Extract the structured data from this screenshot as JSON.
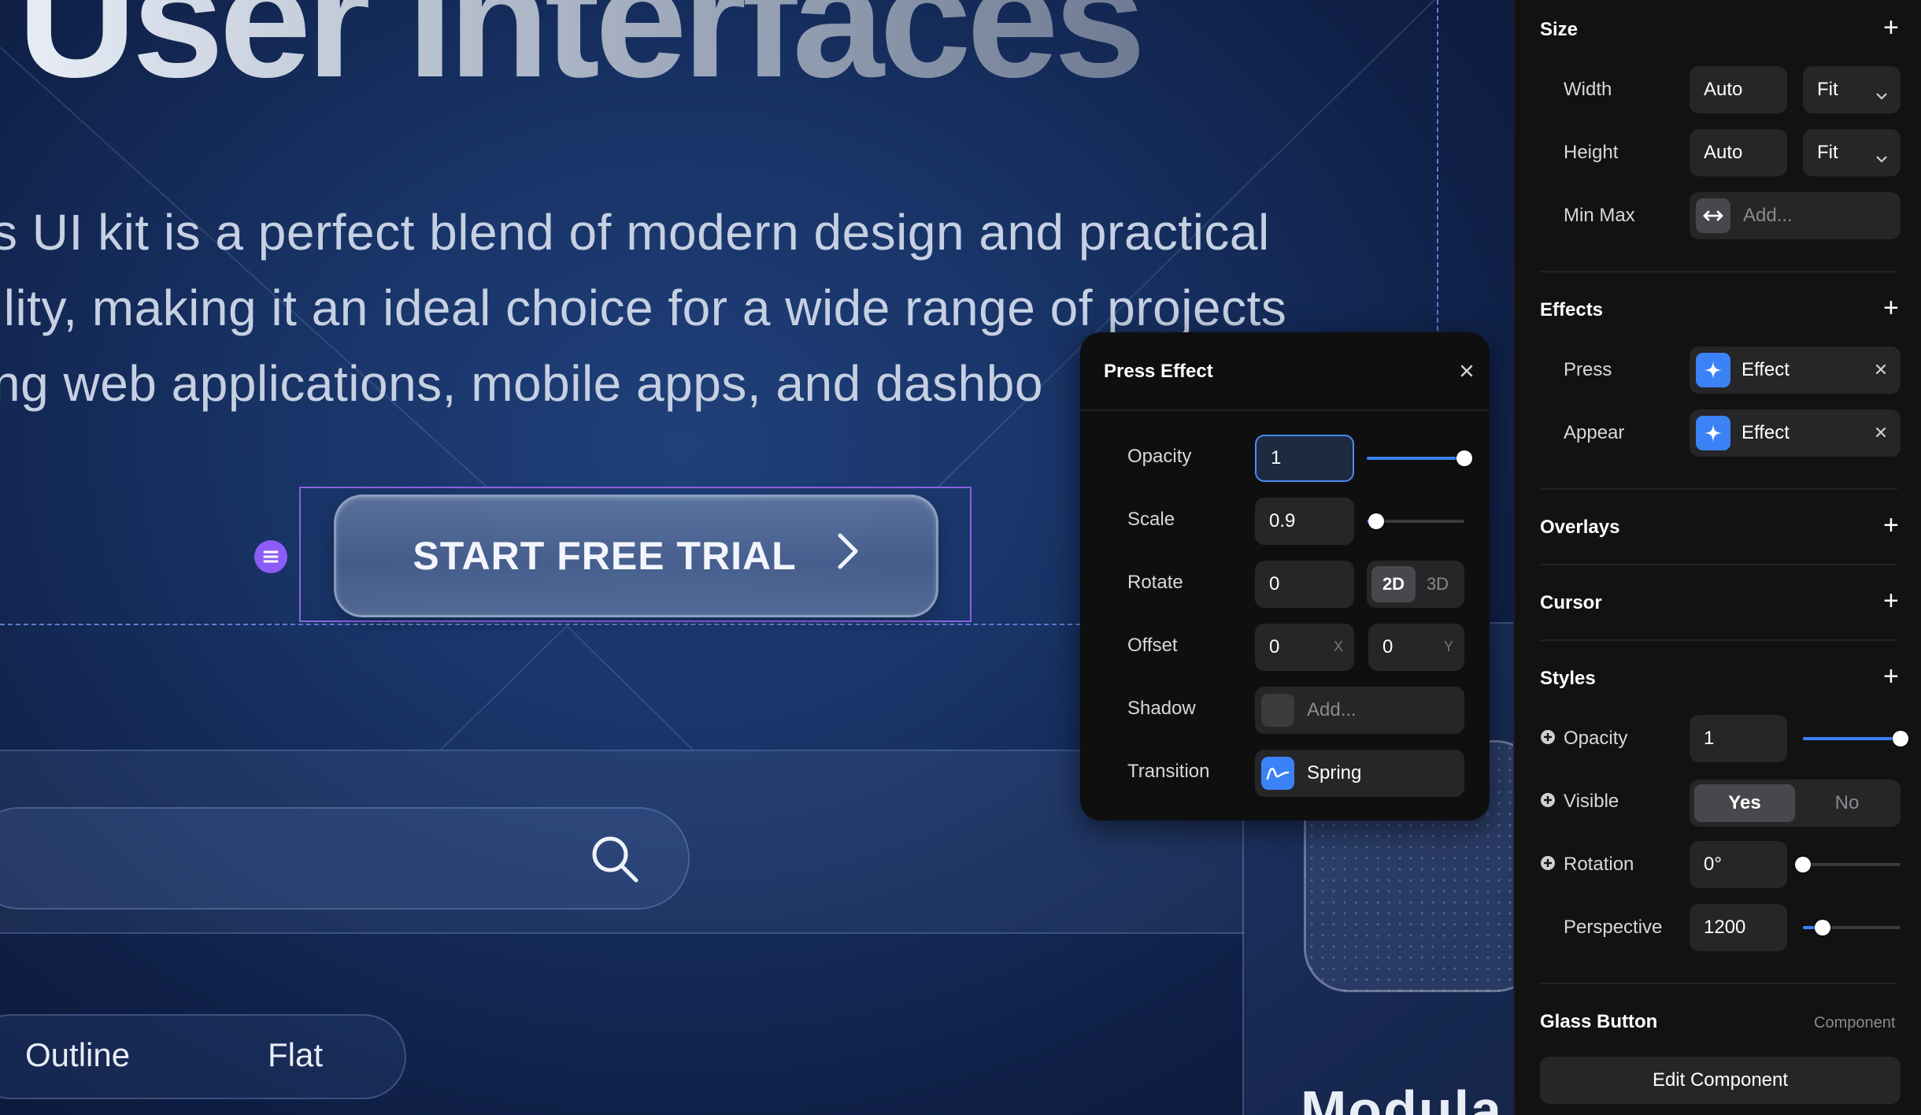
{
  "canvas": {
    "hero_title": "User Interfaces",
    "description_lines": [
      "s UI kit is a perfect blend of modern design and practical",
      "ility, making it an ideal choice for a wide range of projects",
      "ng web applications, mobile apps, and dashbo"
    ],
    "cta_label": "START FREE TRIAL",
    "segment_labels": [
      "Outline",
      "Flat"
    ],
    "bottom_heading": "Modula"
  },
  "popover": {
    "title": "Press Effect",
    "rows": {
      "opacity": {
        "label": "Opacity",
        "value": "1",
        "slider": 1.0
      },
      "scale": {
        "label": "Scale",
        "value": "0.9",
        "slider": 0.1
      },
      "rotate": {
        "label": "Rotate",
        "value": "0",
        "mode_options": [
          "2D",
          "3D"
        ],
        "mode_selected": "2D"
      },
      "offset": {
        "label": "Offset",
        "x": "0",
        "y": "0",
        "x_axis": "X",
        "y_axis": "Y"
      },
      "shadow": {
        "label": "Shadow",
        "placeholder": "Add..."
      },
      "transition": {
        "label": "Transition",
        "value": "Spring"
      }
    }
  },
  "sidebar": {
    "size": {
      "title": "Size",
      "width_label": "Width",
      "width_value": "Auto",
      "width_mode": "Fit",
      "height_label": "Height",
      "height_value": "Auto",
      "height_mode": "Fit",
      "minmax_label": "Min Max",
      "minmax_placeholder": "Add..."
    },
    "effects": {
      "title": "Effects",
      "items": [
        {
          "label": "Press",
          "value": "Effect"
        },
        {
          "label": "Appear",
          "value": "Effect"
        }
      ]
    },
    "overlays_title": "Overlays",
    "cursor_title": "Cursor",
    "styles": {
      "title": "Styles",
      "opacity_label": "Opacity",
      "opacity_value": "1",
      "opacity_slider": 1.0,
      "visible_label": "Visible",
      "visible_options": [
        "Yes",
        "No"
      ],
      "visible_selected": "Yes",
      "rotation_label": "Rotation",
      "rotation_value": "0°",
      "rotation_slider": 0.0,
      "perspective_label": "Perspective",
      "perspective_value": "1200",
      "perspective_slider": 0.2
    },
    "component": {
      "title": "Glass Button",
      "tag": "Component",
      "edit_label": "Edit Component"
    }
  },
  "colors": {
    "accent": "#3b82f6",
    "selection": "#8b5cf6",
    "panel_bg": "#121213",
    "popover_bg": "#0f0f10",
    "field_bg": "#262628"
  },
  "icons": [
    "menu-handle-icon",
    "chevron-right-icon",
    "search-icon",
    "close-icon",
    "chevron-down-icon",
    "resize-horizontal-icon",
    "sparkle-icon",
    "spring-curve-icon",
    "plus-icon",
    "plus-circle-icon"
  ]
}
